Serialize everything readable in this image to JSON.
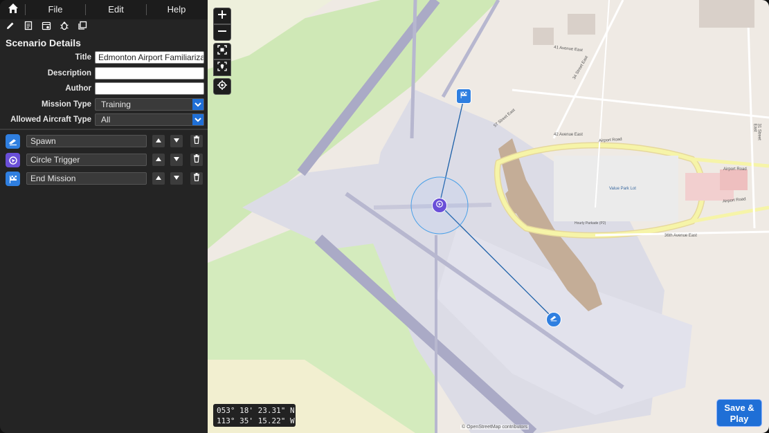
{
  "menu": {
    "items": [
      {
        "label": "File"
      },
      {
        "label": "Edit"
      },
      {
        "label": "Help"
      }
    ]
  },
  "scenario": {
    "section_title": "Scenario Details",
    "title_label": "Title",
    "title_value": "Edmonton Airport Familiarization",
    "description_label": "Description",
    "description_value": "",
    "author_label": "Author",
    "author_value": "",
    "mission_type_label": "Mission Type",
    "mission_type_value": "Training",
    "aircraft_type_label": "Allowed Aircraft Type",
    "aircraft_type_value": "All"
  },
  "steps": [
    {
      "label": "Spawn",
      "icon": "plane-takeoff-icon",
      "color": "#2f7fe0"
    },
    {
      "label": "Circle Trigger",
      "icon": "target-trigger-icon",
      "color": "#6a4fd8"
    },
    {
      "label": "End Mission",
      "icon": "flag-icon",
      "color": "#2f7fe0"
    }
  ],
  "map": {
    "coord_lat": "053° 18' 23.31\" N",
    "coord_lon": "113° 35' 15.22\" W",
    "attribution": "© OpenStreetMap contributors",
    "save_line1": "Save &",
    "save_line2": "Play",
    "labels": {
      "airport_road": "Airport Road",
      "value_park": "Value Park Lot",
      "avenue_41": "41 Avenue East",
      "avenue_42": "42 Avenue East",
      "avenue_36": "36th Avenue East",
      "street_34": "34 Street East",
      "street_57": "57 Street East",
      "street_31": "31 Street East",
      "parkade": "Hourly Parkade (P2)"
    }
  },
  "colors": {
    "accent": "#1f6fd6",
    "sidebar_bg": "#242424",
    "map_bg": "#efeae4",
    "runway": "#aaaac6",
    "apron": "#dcdce6",
    "grass": "#c9e6b0",
    "terminal": "#c4ad97",
    "road_yellow": "#f6f4a8"
  }
}
